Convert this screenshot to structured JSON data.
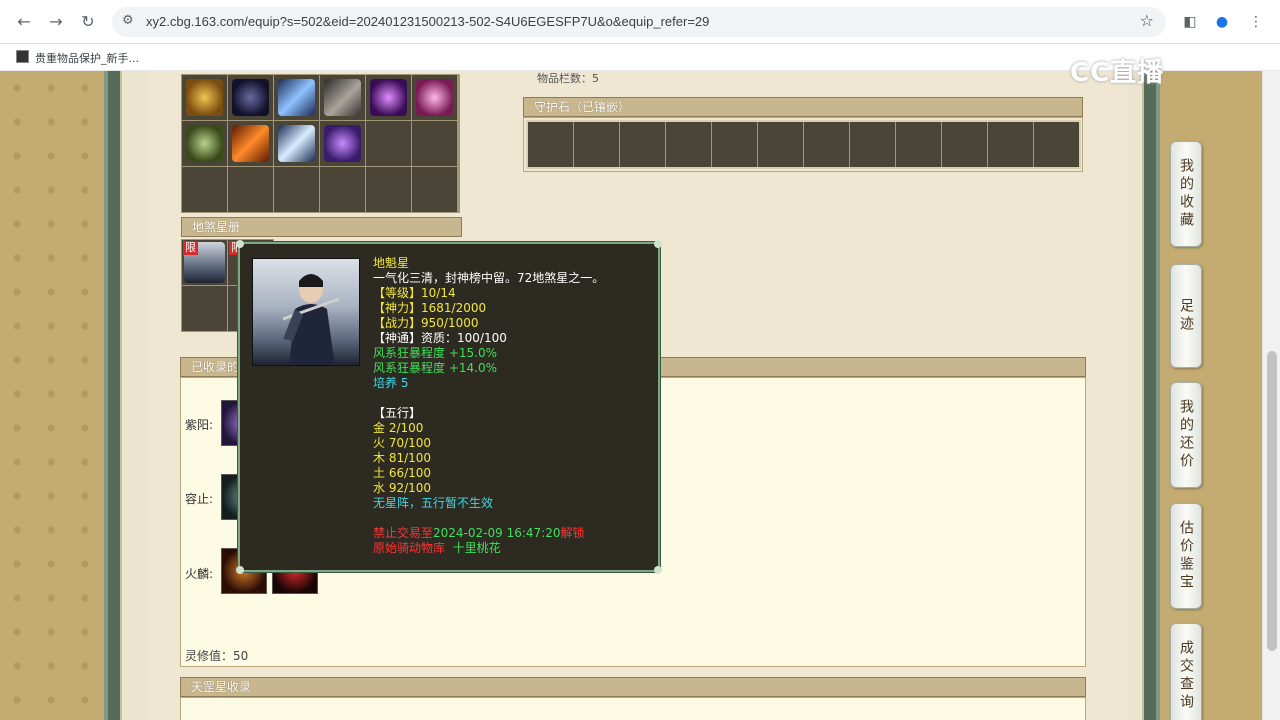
{
  "browser": {
    "url": "xy2.cbg.163.com/equip?s=502&eid=202401231500213-502-S4U6EGESFP7U&o&equip_refer=29",
    "bookmark_label": "贵重物品保护_新手..."
  },
  "watermark": "CC直播",
  "top_note": "物品栏数：5",
  "guard_stone": {
    "title": "守护石（已镶嵌）"
  },
  "disha": {
    "title": "地煞星册",
    "limit_badge": "限"
  },
  "collected": {
    "title": "已收录的",
    "rows": [
      {
        "label": "紫阳:"
      },
      {
        "label": "容止:"
      },
      {
        "label": "火麟:"
      }
    ],
    "ling_xiu": "灵修值：50"
  },
  "tiangang": {
    "title": "天罡星收录"
  },
  "side_tabs": [
    {
      "label": "我的收藏"
    },
    {
      "label": "足迹"
    },
    {
      "label": "我的还价"
    },
    {
      "label": "估价鉴宝"
    },
    {
      "label": "成交查询"
    }
  ],
  "tooltip": {
    "name": "地魁星",
    "desc": "一气化三清，封神榜中留。72地煞星之一。",
    "level": "【等级】10/14",
    "shenli": "【神力】1681/2000",
    "zhanli": "【战力】950/1000",
    "shentong": "【神通】资质：100/100",
    "attr1": "风系狂暴程度 +15.0%",
    "attr2": "风系狂暴程度 +14.0%",
    "peiyang": "培养 5",
    "wuxing_title": "【五行】",
    "jin": "金 2/100",
    "huo": "火 70/100",
    "mu": "木 81/100",
    "tu": "土 66/100",
    "shui": "水 92/100",
    "no_array": "无星阵，五行暂不生效",
    "lock_prefix": "禁止交易至",
    "lock_time": "2024-02-09 16:47:20",
    "lock_suffix": "解锁",
    "origin_prefix": "原始骑动物库",
    "origin_value": "十里桃花"
  }
}
